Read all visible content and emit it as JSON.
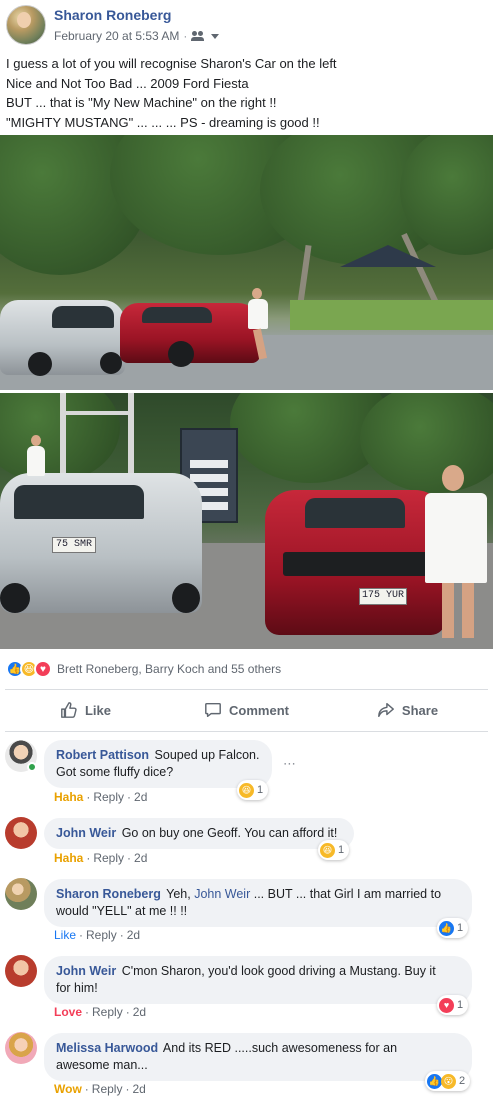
{
  "post": {
    "author": "Sharon Roneberg",
    "timestamp": "February 20 at 5:53 AM",
    "separator": "·",
    "audience_icon": "friends-icon",
    "lines": [
      "I guess a lot of you will recognise Sharon's Car on the left",
      "Nice and Not Too Bad ... 2009 Ford Fiesta",
      "BUT ... that is \"My New Machine\" on the right !!",
      "\"MIGHTY MUSTANG\" ... ... ... PS - dreaming is good !!"
    ],
    "photos": [
      {
        "plates": []
      },
      {
        "plates": [
          "75 SMR",
          "175 YUR"
        ]
      }
    ]
  },
  "reactions": {
    "icons": [
      "like",
      "haha",
      "love"
    ],
    "summary": "Brett Roneberg, Barry Koch and 55 others"
  },
  "actions": {
    "like": "Like",
    "comment": "Comment",
    "share": "Share"
  },
  "comments": [
    {
      "author": "Robert Pattison",
      "text_lines": [
        "Souped up Falcon.",
        "Got some fluffy dice?"
      ],
      "my_reaction": "Haha",
      "reply": "Reply",
      "time": "2d",
      "reaction_count": "1",
      "reaction_type": "haha"
    },
    {
      "author": "John Weir",
      "text": "Go on buy one Geoff. You can afford it!",
      "my_reaction": "Haha",
      "reply": "Reply",
      "time": "2d",
      "reaction_count": "1",
      "reaction_type": "haha"
    },
    {
      "author": "Sharon Roneberg",
      "text_a": "Yeh,",
      "mention": "John Weir",
      "text_b": "... BUT ... that Girl I am married to",
      "text_line2": "would \"YELL\" at me !! !!",
      "my_reaction": "Like",
      "reply": "Reply",
      "time": "2d",
      "reaction_count": "1",
      "reaction_type": "like"
    },
    {
      "author": "John Weir",
      "text": "C'mon Sharon, you'd look good driving a Mustang. Buy it",
      "text_line2": "for him!",
      "my_reaction": "Love",
      "reply": "Reply",
      "time": "2d",
      "reaction_count": "1",
      "reaction_type": "love"
    },
    {
      "author": "Melissa Harwood",
      "text": "And its RED .....such awesomeness for an",
      "text_line2": "awesome man...",
      "my_reaction": "Wow",
      "reply": "Reply",
      "time": "2d",
      "reaction_count": "2",
      "reaction_type": "like+wow"
    }
  ],
  "colors": {
    "link": "#385898",
    "meta": "#606770",
    "bubble": "#f0f2f5",
    "like_blue": "#1877f2",
    "love_red": "#f33e58",
    "haha_yellow": "#f7b928"
  }
}
